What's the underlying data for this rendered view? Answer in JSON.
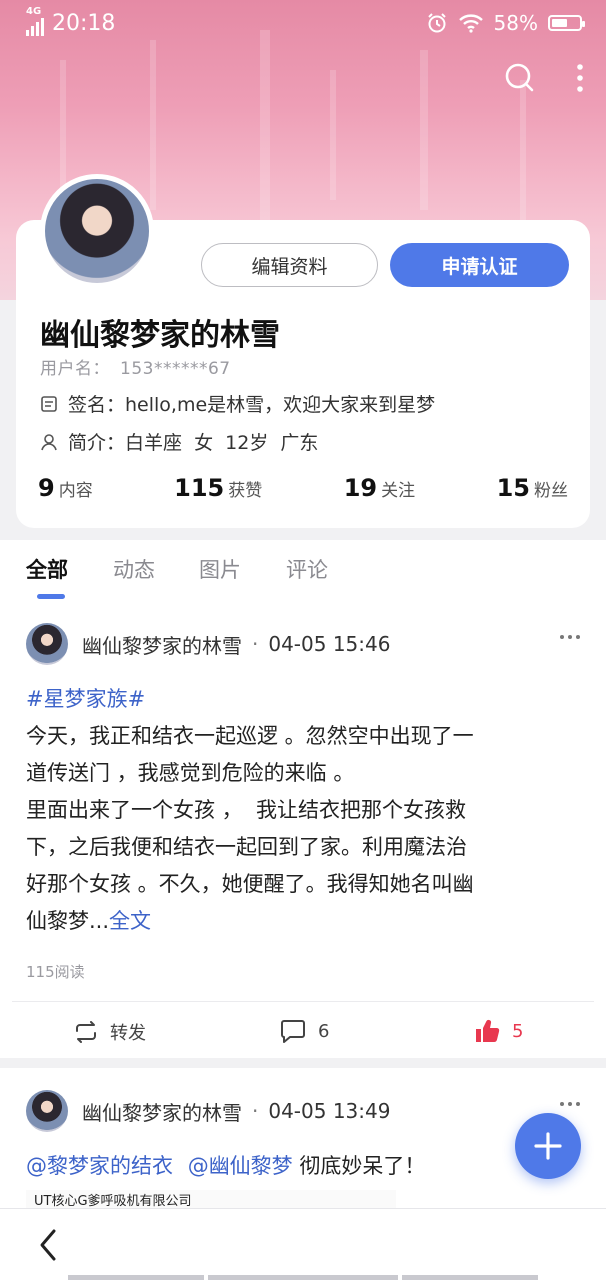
{
  "status_bar": {
    "network": "4G",
    "time": "20:18",
    "battery": "58%",
    "battery_level": 0.58
  },
  "header_icons": [
    "search-icon",
    "more-vertical-icon"
  ],
  "profile": {
    "name": "幽仙黎梦家的林雪",
    "username_label": "用户名：",
    "username": "153******67",
    "signature_label": "签名：",
    "signature": "hello,me是林雪，欢迎大家来到星梦",
    "intro_label": "简介：",
    "intro": "白羊座  女  12岁  广东",
    "edit_button": "编辑资料",
    "apply_button": "申请认证",
    "stats": [
      {
        "value": "9",
        "label": "内容"
      },
      {
        "value": "115",
        "label": "获赞"
      },
      {
        "value": "19",
        "label": "关注"
      },
      {
        "value": "15",
        "label": "粉丝"
      }
    ]
  },
  "tabs": [
    "全部",
    "动态",
    "图片",
    "评论"
  ],
  "posts": [
    {
      "author": "幽仙黎梦家的林雪",
      "time": "04-05 15:46",
      "tag": "#星梦家族#",
      "lines": [
        "今天，我正和结衣一起巡逻 。忽然空中出现了一",
        "道传送门 ，我感觉到危险的来临 。",
        "里面出来了一个女孩 ，  我让结衣把那个女孩救",
        "下，之后我便和结衣一起回到了家。利用魔法治",
        "好那个女孩 。不久，她便醒了。我得知她名叫幽",
        "仙黎梦..."
      ],
      "full_text_link": "全文",
      "reads": "115阅读",
      "repost_label": "转发",
      "comments": "6",
      "likes": "5"
    },
    {
      "author": "幽仙黎梦家的林雪",
      "time": "04-05 13:49",
      "mentions": [
        "@黎梦家的结衣",
        "@幽仙黎梦"
      ],
      "text": " 彻底妙呆了！",
      "image_caption": "UT核心G爹呼吸机有限公司"
    }
  ],
  "fab_icon": "plus-icon",
  "nav": {
    "back_icon": "back-arrow-icon"
  },
  "colors": {
    "accent": "#4f79e8",
    "like": "#e8384f",
    "tag": "#3d63c9"
  }
}
